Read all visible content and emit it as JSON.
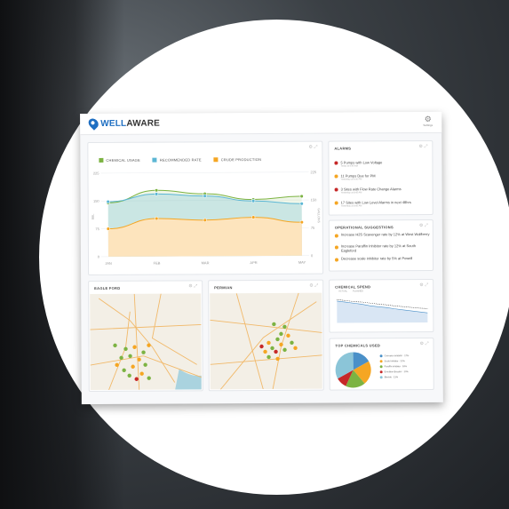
{
  "brand": {
    "name_part1": "WELL",
    "name_part2": "AWARE"
  },
  "settings_label": "Settings",
  "main_chart": {
    "legend": [
      {
        "label": "CHEMICAL USAGE",
        "color": "#7cb342"
      },
      {
        "label": "RECOMMENDED RATE",
        "color": "#5bb6d4"
      },
      {
        "label": "CRUDE PRODUCTION",
        "color": "#f5a623"
      }
    ],
    "ylabel_left": "BBL",
    "ylabel_right": "GALLONS",
    "chart_data": {
      "type": "area",
      "categories": [
        "JAN",
        "FEB",
        "MAR",
        "APR",
        "MAY"
      ],
      "y_ticks": [
        0,
        75,
        150,
        225
      ],
      "ylim": [
        0,
        225
      ],
      "series": [
        {
          "name": "CHEMICAL USAGE",
          "color": "#7cb342",
          "x": [
            0,
            1,
            2,
            3,
            4
          ],
          "values": [
            145,
            178,
            168,
            152,
            160
          ]
        },
        {
          "name": "RECOMMENDED RATE",
          "color": "#5bb6d4",
          "x": [
            0,
            1,
            2,
            3,
            4
          ],
          "values": [
            148,
            168,
            162,
            148,
            140
          ]
        },
        {
          "name": "CRUDE PRODUCTION",
          "color": "#f5a623",
          "x": [
            0,
            1,
            2,
            3,
            4
          ],
          "values": [
            75,
            102,
            97,
            104,
            90
          ]
        }
      ]
    }
  },
  "alarms": {
    "title": "ALARMS",
    "items": [
      {
        "text": "5 Pumps with Low Voltage",
        "sub": "Today at 8:45 AM",
        "color": "#c62828"
      },
      {
        "text": "11 Pumps Due for PM",
        "sub": "Yesterday at 4:00 PM",
        "color": "#f5a623"
      },
      {
        "text": "3 Sites with Flow Rate Change Alarms",
        "sub": "Yesterday at 8:45 AM",
        "color": "#c62828"
      },
      {
        "text": "17 Sites with Low Level Alarms in next 48hrs",
        "sub": "Yesterday at 8:45 AM",
        "color": "#f5a623"
      }
    ]
  },
  "suggestions": {
    "title": "OPERATIONAL SUGGESTIONS",
    "items": [
      {
        "text": "Increase H2S Scavenger rate by 12% at West Wolfberry",
        "color": "#f5a623"
      },
      {
        "text": "Increase Paraffin Inhibitor rate by 12% at South Eagleford",
        "color": "#f5a623"
      },
      {
        "text": "Decrease scale inhibitor rate by 5% at Powell",
        "color": "#f5a623"
      }
    ]
  },
  "maps": [
    {
      "title": "EAGLE FORD"
    },
    {
      "title": "PERMIAN"
    }
  ],
  "spend": {
    "title": "CHEMICAL SPEND",
    "legend_actual": "ACTUAL",
    "legend_planned": "PLANNED",
    "chart_data": {
      "type": "line",
      "series": [
        {
          "name": "ACTUAL",
          "values": [
            82,
            78,
            74,
            70,
            64,
            60,
            57,
            52,
            48,
            44,
            40,
            36
          ]
        },
        {
          "name": "PLANNED",
          "values": [
            88,
            84,
            80,
            78,
            74,
            70,
            67,
            63,
            60,
            57,
            54,
            52
          ]
        }
      ]
    }
  },
  "top_chem": {
    "title": "TOP CHEMICALS USED",
    "chart_data": {
      "type": "pie",
      "slices": [
        {
          "label": "Corrosion Inhibitor - 17%",
          "value": 17,
          "color": "#4a90c8"
        },
        {
          "label": "Scale Inhibitor - 22%",
          "value": 22,
          "color": "#f5a623"
        },
        {
          "label": "Paraffin Inhibitor - 18%",
          "value": 18,
          "color": "#7cb342"
        },
        {
          "label": "Emulsion Breaker - 10%",
          "value": 10,
          "color": "#c62828"
        },
        {
          "label": "Biocide - 13%",
          "value": 33,
          "color": "#8bc5d8"
        }
      ]
    }
  }
}
